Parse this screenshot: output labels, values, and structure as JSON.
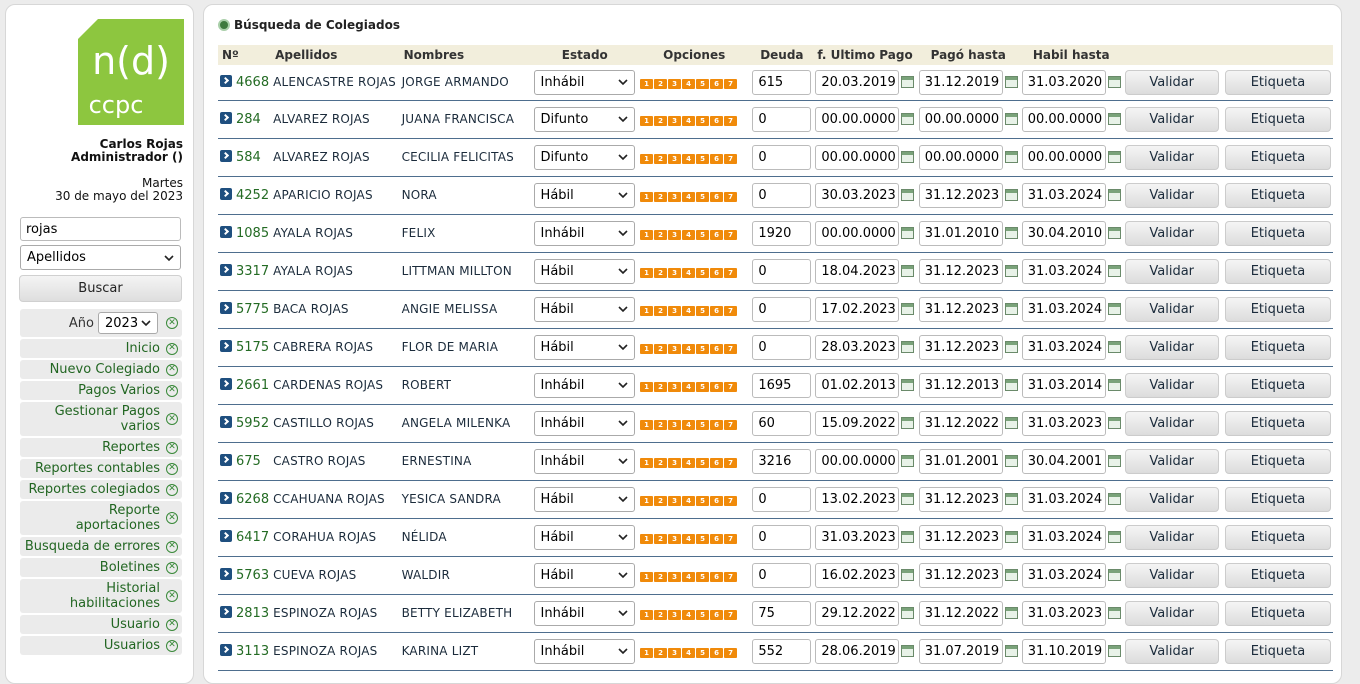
{
  "sidebar": {
    "logo_text_top": "n(d)",
    "logo_text_bottom": "ccpc",
    "user_name": "Carlos Rojas",
    "user_role": "Administrador ()",
    "day": "Martes",
    "date": "30 de mayo del 2023",
    "search_value": "rojas",
    "search_field": "Apellidos",
    "search_button": "Buscar",
    "year_label": "Año",
    "year_value": "2023",
    "menu": [
      "Inicio",
      "Nuevo Colegiado",
      "Pagos Varios",
      "Gestionar Pagos varios",
      "Reportes",
      "Reportes contables",
      "Reportes colegiados",
      "Reporte aportaciones",
      "Busqueda de errores",
      "Boletines",
      "Historial habilitaciones",
      "Usuario",
      "Usuarios"
    ]
  },
  "main": {
    "title": "Búsqueda de Colegiados",
    "columns": {
      "num": "Nº",
      "apellidos": "Apellidos",
      "nombres": "Nombres",
      "estado": "Estado",
      "opciones": "Opciones",
      "deuda": "Deuda",
      "ultimo_pago": "f. Ultimo Pago",
      "pago_hasta": "Pagó hasta",
      "habil_hasta": "Habil hasta"
    },
    "option_labels": [
      "1",
      "2",
      "3",
      "4",
      "5",
      "6",
      "7"
    ],
    "validar_label": "Validar",
    "etiqueta_label": "Etiqueta",
    "rows": [
      {
        "num": "4668",
        "apellidos": "ALENCASTRE ROJAS",
        "nombres": "JORGE ARMANDO",
        "estado": "Inhábil",
        "deuda": "615",
        "ultimo": "20.03.2019",
        "pago": "31.12.2019",
        "habil": "31.03.2020"
      },
      {
        "num": "284",
        "apellidos": "ALVAREZ ROJAS",
        "nombres": "JUANA FRANCISCA",
        "estado": "Difunto",
        "deuda": "0",
        "ultimo": "00.00.0000",
        "pago": "00.00.0000",
        "habil": "00.00.0000"
      },
      {
        "num": "584",
        "apellidos": "ALVAREZ ROJAS",
        "nombres": "CECILIA FELICITAS",
        "estado": "Difunto",
        "deuda": "0",
        "ultimo": "00.00.0000",
        "pago": "00.00.0000",
        "habil": "00.00.0000"
      },
      {
        "num": "4252",
        "apellidos": "APARICIO ROJAS",
        "nombres": "NORA",
        "estado": "Hábil",
        "deuda": "0",
        "ultimo": "30.03.2023",
        "pago": "31.12.2023",
        "habil": "31.03.2024"
      },
      {
        "num": "1085",
        "apellidos": "AYALA ROJAS",
        "nombres": "FELIX",
        "estado": "Inhábil",
        "deuda": "1920",
        "ultimo": "00.00.0000",
        "pago": "31.01.2010",
        "habil": "30.04.2010"
      },
      {
        "num": "3317",
        "apellidos": "AYALA ROJAS",
        "nombres": "LITTMAN MILLTON",
        "estado": "Hábil",
        "deuda": "0",
        "ultimo": "18.04.2023",
        "pago": "31.12.2023",
        "habil": "31.03.2024"
      },
      {
        "num": "5775",
        "apellidos": "BACA ROJAS",
        "nombres": "ANGIE MELISSA",
        "estado": "Hábil",
        "deuda": "0",
        "ultimo": "17.02.2023",
        "pago": "31.12.2023",
        "habil": "31.03.2024"
      },
      {
        "num": "5175",
        "apellidos": "CABRERA ROJAS",
        "nombres": "FLOR DE MARIA",
        "estado": "Hábil",
        "deuda": "0",
        "ultimo": "28.03.2023",
        "pago": "31.12.2023",
        "habil": "31.03.2024"
      },
      {
        "num": "2661",
        "apellidos": "CARDENAS ROJAS",
        "nombres": "ROBERT",
        "estado": "Inhábil",
        "deuda": "1695",
        "ultimo": "01.02.2013",
        "pago": "31.12.2013",
        "habil": "31.03.2014"
      },
      {
        "num": "5952",
        "apellidos": "CASTILLO ROJAS",
        "nombres": "ANGELA MILENKA",
        "estado": "Inhábil",
        "deuda": "60",
        "ultimo": "15.09.2022",
        "pago": "31.12.2022",
        "habil": "31.03.2023"
      },
      {
        "num": "675",
        "apellidos": "CASTRO ROJAS",
        "nombres": "ERNESTINA",
        "estado": "Inhábil",
        "deuda": "3216",
        "ultimo": "00.00.0000",
        "pago": "31.01.2001",
        "habil": "30.04.2001"
      },
      {
        "num": "6268",
        "apellidos": "CCAHUANA ROJAS",
        "nombres": "YESICA SANDRA",
        "estado": "Hábil",
        "deuda": "0",
        "ultimo": "13.02.2023",
        "pago": "31.12.2023",
        "habil": "31.03.2024"
      },
      {
        "num": "6417",
        "apellidos": "CORAHUA ROJAS",
        "nombres": "NÉLIDA",
        "estado": "Hábil",
        "deuda": "0",
        "ultimo": "31.03.2023",
        "pago": "31.12.2023",
        "habil": "31.03.2024"
      },
      {
        "num": "5763",
        "apellidos": "CUEVA ROJAS",
        "nombres": "WALDIR",
        "estado": "Hábil",
        "deuda": "0",
        "ultimo": "16.02.2023",
        "pago": "31.12.2023",
        "habil": "31.03.2024"
      },
      {
        "num": "2813",
        "apellidos": "ESPINOZA ROJAS",
        "nombres": "BETTY ELIZABETH",
        "estado": "Inhábil",
        "deuda": "75",
        "ultimo": "29.12.2022",
        "pago": "31.12.2022",
        "habil": "31.03.2023"
      },
      {
        "num": "3113",
        "apellidos": "ESPINOZA ROJAS",
        "nombres": "KARINA LIZT",
        "estado": "Inhábil",
        "deuda": "552",
        "ultimo": "28.06.2019",
        "pago": "31.07.2019",
        "habil": "31.10.2019"
      }
    ]
  }
}
